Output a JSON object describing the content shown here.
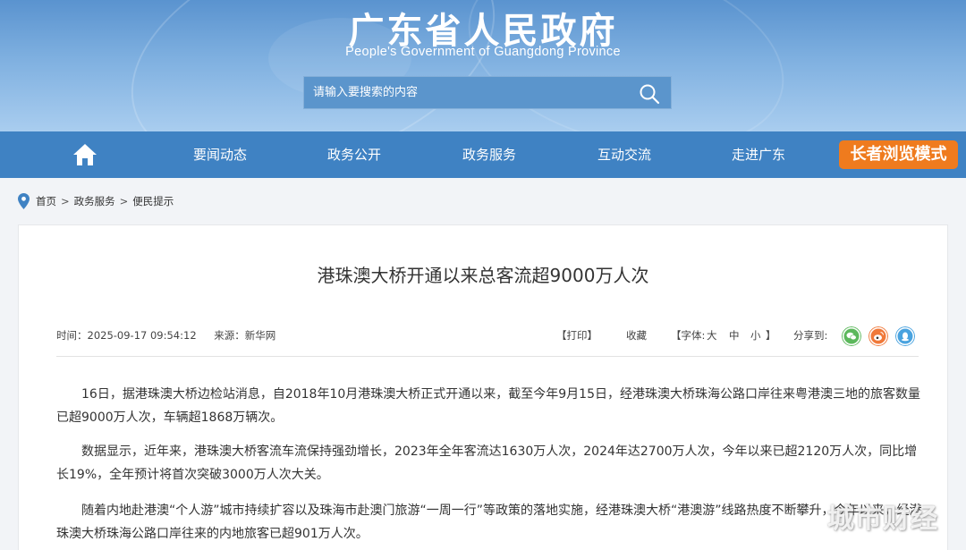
{
  "header": {
    "title": "广东省人民政府",
    "subtitle": "People's Government of Guangdong Province",
    "search_placeholder": "请输入要搜索的内容"
  },
  "nav": {
    "items": [
      {
        "label": "要闻动态"
      },
      {
        "label": "政务公开"
      },
      {
        "label": "政务服务"
      },
      {
        "label": "互动交流"
      },
      {
        "label": "走进广东"
      }
    ],
    "elder_mode": "长者浏览模式"
  },
  "breadcrumb": {
    "items": [
      "首页",
      "政务服务",
      "便民提示"
    ],
    "separator": ">"
  },
  "article": {
    "title": "港珠澳大桥开通以来总客流超9000万人次",
    "time": "时间：2025-09-17 09:54:12",
    "source": "来源：新华网",
    "print": "【打印】",
    "favorite": "收藏",
    "font_prefix": "【字体:",
    "font_large": "大",
    "font_medium": "中",
    "font_small": "小",
    "font_suffix": "】",
    "share_label": "分享到:",
    "paragraphs": [
      "16日，据港珠澳大桥边检站消息，自2018年10月港珠澳大桥正式开通以来，截至今年9月15日，经港珠澳大桥珠海公路口岸往来粤港澳三地的旅客数量已超9000万人次，车辆超1868万辆次。",
      "数据显示，近年来，港珠澳大桥客流车流保持强劲增长，2023年全年客流达1630万人次，2024年达2700万人次，今年以来已超2120万人次，同比增长19%，全年预计将首次突破3000万人次大关。",
      "随着内地赴港澳“个人游”城市持续扩容以及珠海市赴澳门旅游“一周一行”等政策的落地实施，经港珠澳大桥“港澳游”线路热度不断攀升，今年以来，经港珠澳大桥珠海公路口岸往来的内地旅客已超901万人次。"
    ]
  },
  "watermark": "城市财经",
  "colors": {
    "nav_bg": "#3f82c3",
    "elder_btn": "#ef7b1e",
    "wechat": "#5cb85c",
    "weibo": "#f0793a",
    "qq": "#4aa3df"
  }
}
